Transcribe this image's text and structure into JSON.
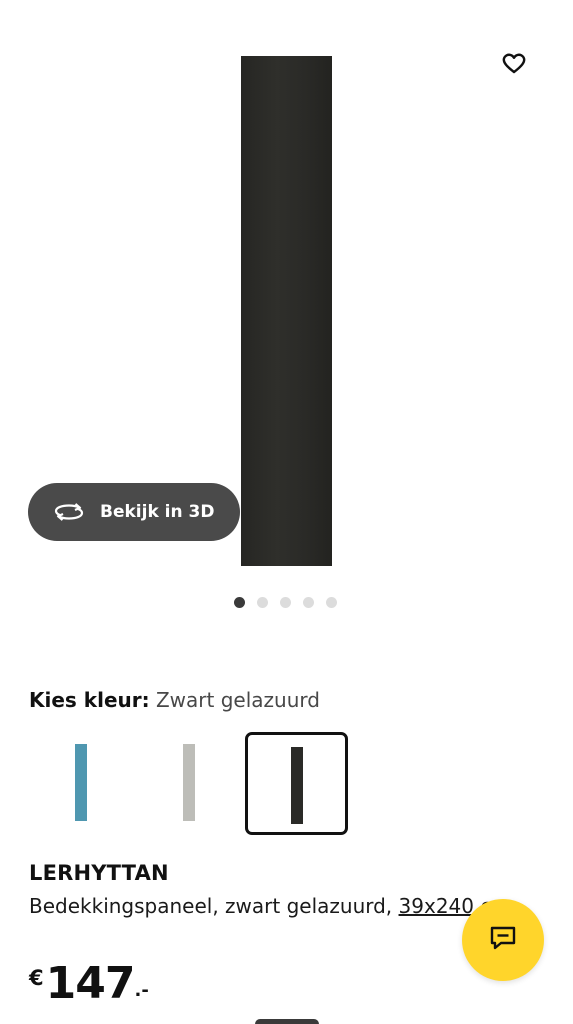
{
  "gallery": {
    "view_3d_label": "Bekijk in 3D",
    "image_count": 5,
    "active_image": 1
  },
  "colour": {
    "label": "Kies kleur:",
    "selected": "Zwart gelazuurd",
    "swatches": [
      {
        "name": "blue",
        "color": "#4f97b0",
        "selected": false
      },
      {
        "name": "light-grey",
        "color": "#bdbdb8",
        "selected": false
      },
      {
        "name": "black",
        "color": "#2a2a27",
        "selected": true
      }
    ]
  },
  "product": {
    "name": "LERHYTTAN",
    "description": "Bedekkingspaneel, zwart gelazuurd,",
    "size_link": "39x240 cm",
    "price_currency": "€",
    "price_integer": "147",
    "price_decimal": ".-"
  },
  "colors": {
    "chat_button": "#ffd52b",
    "button_dark": "#4a4a4a"
  },
  "icons": [
    "heart-icon",
    "rotate-3d-icon",
    "chat-icon"
  ]
}
